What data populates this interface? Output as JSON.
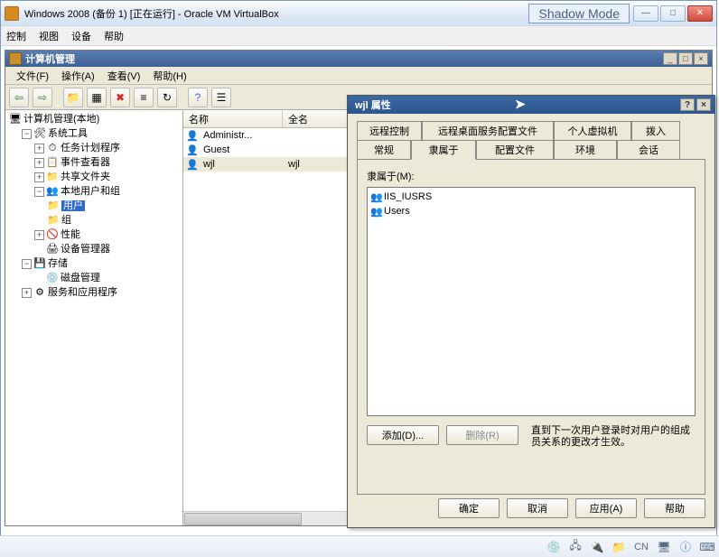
{
  "vbox": {
    "title": "Windows 2008 (备份 1) [正在运行] - Oracle VM VirtualBox",
    "shadow_mode": "Shadow Mode",
    "menus": {
      "control": "控制",
      "view": "视图",
      "devices": "设备",
      "help": "帮助"
    }
  },
  "mmc": {
    "title": "计算机管理",
    "menus": {
      "file": "文件(F)",
      "action": "操作(A)",
      "view": "查看(V)",
      "help": "帮助(H)"
    }
  },
  "tree": {
    "root": "计算机管理(本地)",
    "system_tools": "系统工具",
    "task_scheduler": "任务计划程序",
    "event_viewer": "事件查看器",
    "shared_folders": "共享文件夹",
    "local_users": "本地用户和组",
    "users": "用户",
    "groups": "组",
    "performance": "性能",
    "device_mgr": "设备管理器",
    "storage": "存储",
    "disk_mgmt": "磁盘管理",
    "services": "服务和应用程序"
  },
  "list": {
    "col_name": "名称",
    "col_full": "全名",
    "rows": [
      {
        "name": "Administr...",
        "full": ""
      },
      {
        "name": "Guest",
        "full": ""
      },
      {
        "name": "wjl",
        "full": "wjl"
      }
    ]
  },
  "props": {
    "title": "wjl 属性",
    "tabs_row1": [
      "远程控制",
      "远程桌面服务配置文件",
      "个人虚拟机",
      "拨入"
    ],
    "tabs_row2": [
      "常规",
      "隶属于",
      "配置文件",
      "环境",
      "会话"
    ],
    "member_of_label": "隶属于(M):",
    "members": [
      "IIS_IUSRS",
      "Users"
    ],
    "add_btn": "添加(D)...",
    "remove_btn": "删除(R)",
    "hint": "直到下一次用户登录时对用户的组成员关系的更改才生效。",
    "ok": "确定",
    "cancel": "取消",
    "apply": "应用(A)",
    "help": "帮助"
  },
  "statusbar": {
    "cn": "CN"
  }
}
